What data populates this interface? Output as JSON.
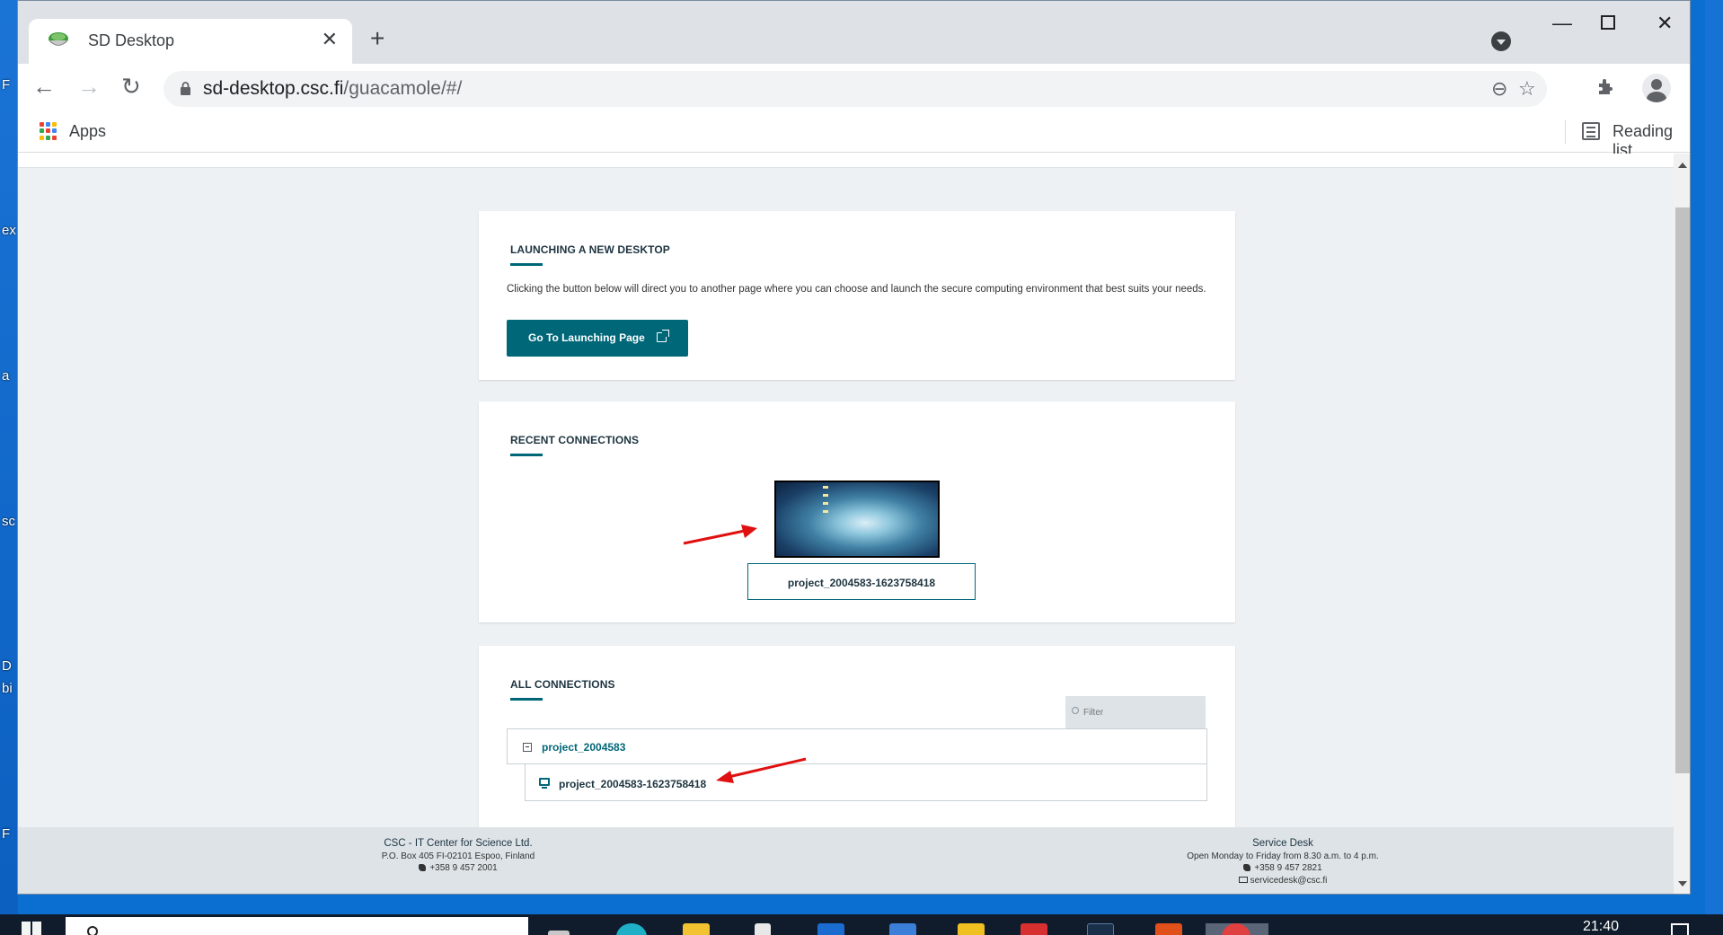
{
  "browser": {
    "tab_title": "SD Desktop",
    "new_tab": "+",
    "close_tab": "✕",
    "url_domain": "sd-desktop.csc.fi",
    "url_path": "/guacamole/#/",
    "bookmarks": {
      "apps_label": "Apps",
      "reading_list_label": "Reading list"
    }
  },
  "desktop_fragments": [
    "F",
    "ex",
    "a",
    "sc",
    "D",
    "bi",
    "F"
  ],
  "launch_card": {
    "heading": "LAUNCHING A NEW DESKTOP",
    "description": "Clicking the button below will direct you to another page where you can choose and launch the secure computing environment that best suits your needs.",
    "button_label": "Go To Launching Page"
  },
  "recent_card": {
    "heading": "RECENT CONNECTIONS",
    "connection_name": "project_2004583-1623758418"
  },
  "all_card": {
    "heading": "ALL CONNECTIONS",
    "filter_placeholder": "Filter",
    "group_name": "project_2004583",
    "connection_name": "project_2004583-1623758418"
  },
  "footer": {
    "left": {
      "title": "CSC - IT Center for Science Ltd.",
      "address": "P.O. Box 405 FI-02101 Espoo, Finland",
      "phone": "+358 9 457 2001"
    },
    "right": {
      "title": "Service Desk",
      "hours": "Open Monday to Friday from 8.30 a.m. to 4 p.m.",
      "phone": "+358 9 457 2821",
      "email": "servicedesk@csc.fi"
    }
  },
  "taskbar": {
    "clock": "21:40"
  },
  "colors": {
    "brand_teal": "#006778",
    "arrow_red": "#e01010",
    "page_bg": "#edf1f3"
  }
}
